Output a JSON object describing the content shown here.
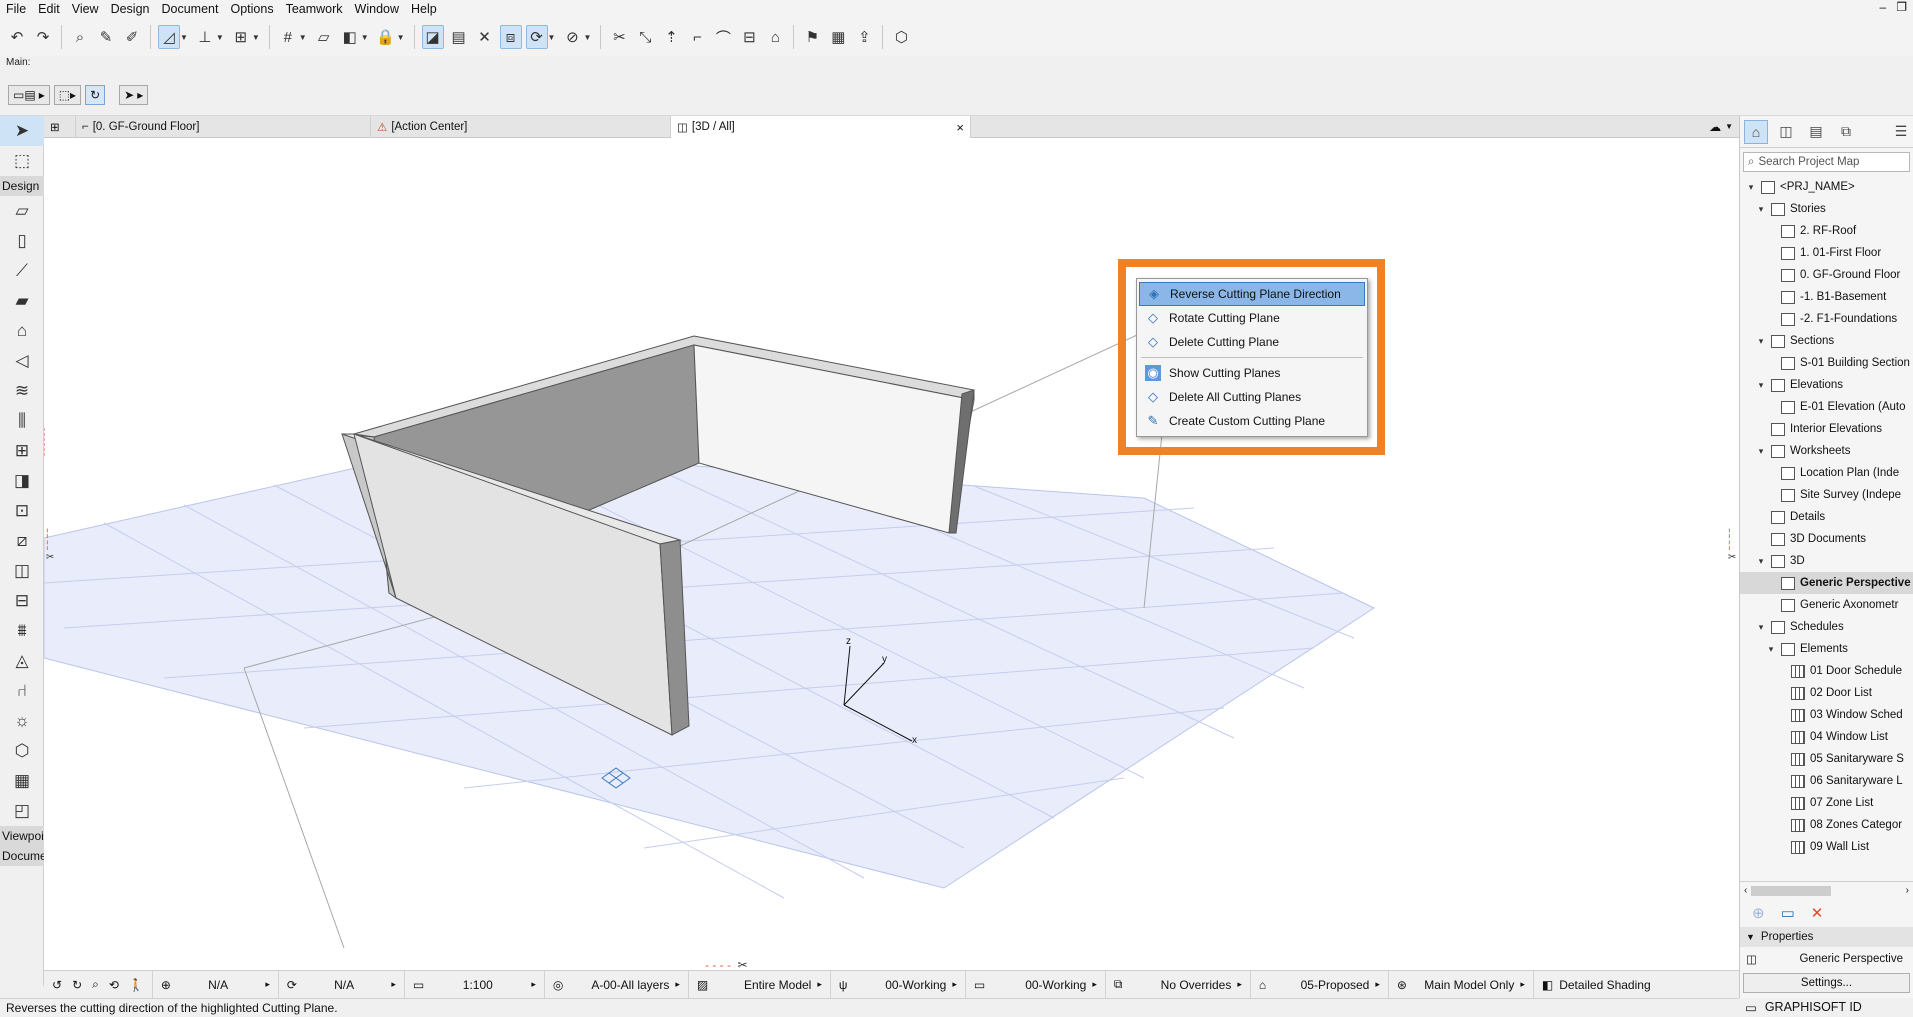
{
  "menu": [
    "File",
    "Edit",
    "View",
    "Design",
    "Document",
    "Options",
    "Teamwork",
    "Window",
    "Help"
  ],
  "toolbar": {
    "main_label": "Main:"
  },
  "toolbox": {
    "design_label": "Design",
    "viewpoint_label": "Viewpoi",
    "document_label": "Docume"
  },
  "tabs": [
    {
      "label": "[0. GF-Ground Floor]",
      "icon": "floor-plan-icon"
    },
    {
      "label": "[Action Center]",
      "icon": "action-center-icon"
    },
    {
      "label": "[3D / All]",
      "icon": "3d-window-icon",
      "close": "×"
    }
  ],
  "context_menu": {
    "items": [
      {
        "label": "Reverse Cutting Plane Direction",
        "icon": "reverse-plane-icon",
        "highlighted": true
      },
      {
        "label": "Rotate Cutting Plane",
        "icon": "rotate-plane-icon"
      },
      {
        "label": "Delete Cutting Plane",
        "icon": "delete-plane-icon"
      },
      {
        "label": "Show Cutting Planes",
        "icon": "show-planes-icon",
        "checked": true
      },
      {
        "label": "Delete All Cutting Planes",
        "icon": "delete-all-planes-icon"
      },
      {
        "label": "Create Custom Cutting Plane",
        "icon": "custom-plane-icon"
      }
    ],
    "highlight_color": "#f08125"
  },
  "axes": {
    "x": "x",
    "y": "y",
    "z": "z"
  },
  "statusbar": {
    "zoom1": "N/A",
    "zoom2": "N/A",
    "scale": "1:100",
    "layers": "A-00-All layers",
    "model": "Entire Model",
    "pen1": "00-Working",
    "pen2": "00-Working",
    "override": "No Overrides",
    "renovation": "05-Proposed",
    "model_view": "Main Model Only",
    "shading": "Detailed Shading"
  },
  "status_line": "Reverses the cutting direction of the highlighted Cutting Plane.",
  "navigator": {
    "search_placeholder": "Search Project Map",
    "tree": [
      {
        "label": "<PRJ_NAME>",
        "indent": 0,
        "toggle": "v",
        "icon": "project-icon"
      },
      {
        "label": "Stories",
        "indent": 1,
        "toggle": "v",
        "icon": "stories-icon"
      },
      {
        "label": "2. RF-Roof",
        "indent": 2,
        "toggle": "",
        "icon": "story-icon"
      },
      {
        "label": "1. 01-First Floor",
        "indent": 2,
        "toggle": "",
        "icon": "story-icon"
      },
      {
        "label": "0. GF-Ground Floor",
        "indent": 2,
        "toggle": "",
        "icon": "story-icon"
      },
      {
        "label": "-1. B1-Basement",
        "indent": 2,
        "toggle": "",
        "icon": "story-icon"
      },
      {
        "label": "-2. F1-Foundations",
        "indent": 2,
        "toggle": "",
        "icon": "story-icon"
      },
      {
        "label": "Sections",
        "indent": 1,
        "toggle": "v",
        "icon": "sections-icon"
      },
      {
        "label": "S-01 Building Section",
        "indent": 2,
        "toggle": "",
        "icon": "section-icon"
      },
      {
        "label": "Elevations",
        "indent": 1,
        "toggle": "v",
        "icon": "elevations-icon"
      },
      {
        "label": "E-01 Elevation (Auto",
        "indent": 2,
        "toggle": "",
        "icon": "elevation-icon"
      },
      {
        "label": "Interior Elevations",
        "indent": 1,
        "toggle": "",
        "icon": "interior-elevations-icon"
      },
      {
        "label": "Worksheets",
        "indent": 1,
        "toggle": "v",
        "icon": "worksheets-icon"
      },
      {
        "label": "Location Plan (Inde",
        "indent": 2,
        "toggle": "",
        "icon": "worksheet-icon"
      },
      {
        "label": "Site Survey (Indepe",
        "indent": 2,
        "toggle": "",
        "icon": "worksheet-icon"
      },
      {
        "label": "Details",
        "indent": 1,
        "toggle": "",
        "icon": "details-icon"
      },
      {
        "label": "3D Documents",
        "indent": 1,
        "toggle": "",
        "icon": "3d-documents-icon"
      },
      {
        "label": "3D",
        "indent": 1,
        "toggle": "v",
        "icon": "3d-icon"
      },
      {
        "label": "Generic Perspective",
        "indent": 2,
        "toggle": "",
        "icon": "perspective-icon",
        "selected": true
      },
      {
        "label": "Generic Axonometr",
        "indent": 2,
        "toggle": "",
        "icon": "axonometry-icon"
      },
      {
        "label": "Schedules",
        "indent": 1,
        "toggle": "v",
        "icon": "schedules-icon"
      },
      {
        "label": "Elements",
        "indent": 2,
        "toggle": "v",
        "icon": "elements-icon"
      },
      {
        "label": "01 Door Schedule",
        "indent": 3,
        "toggle": "",
        "icon": "schedule-icon"
      },
      {
        "label": "02 Door List",
        "indent": 3,
        "toggle": "",
        "icon": "schedule-icon"
      },
      {
        "label": "03 Window Sched",
        "indent": 3,
        "toggle": "",
        "icon": "schedule-icon"
      },
      {
        "label": "04 Window List",
        "indent": 3,
        "toggle": "",
        "icon": "schedule-icon"
      },
      {
        "label": "05 Sanitaryware S",
        "indent": 3,
        "toggle": "",
        "icon": "schedule-icon"
      },
      {
        "label": "06 Sanitaryware L",
        "indent": 3,
        "toggle": "",
        "icon": "schedule-icon"
      },
      {
        "label": "07 Zone List",
        "indent": 3,
        "toggle": "",
        "icon": "schedule-icon"
      },
      {
        "label": "08 Zones Categor",
        "indent": 3,
        "toggle": "",
        "icon": "schedule-icon"
      },
      {
        "label": "09 Wall List",
        "indent": 3,
        "toggle": "",
        "icon": "schedule-icon"
      }
    ],
    "properties_label": "Properties",
    "properties_value": "Generic Perspective",
    "settings_button": "Settings..."
  },
  "brand": "GRAPHISOFT ID",
  "colors": {
    "accent": "#f08125",
    "selection": "#8ab7e8",
    "grid": "#e9edfb"
  }
}
